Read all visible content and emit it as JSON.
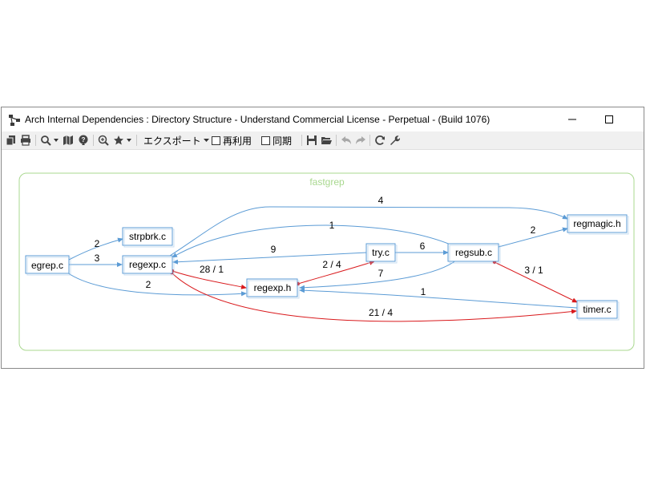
{
  "window": {
    "title": "Arch Internal Dependencies : Directory Structure - Understand Commercial License - Perpetual - (Build 1076)"
  },
  "toolbar": {
    "export_label": "エクスポート",
    "reuse_label": "再利用",
    "sync_label": "同期"
  },
  "graph": {
    "group_label": "fastgrep",
    "nodes": [
      "egrep.c",
      "strpbrk.c",
      "regexp.c",
      "regexp.h",
      "try.c",
      "regsub.c",
      "regmagic.h",
      "timer.c"
    ],
    "edge_labels": {
      "egrep_strpbrk": "2",
      "egrep_regexpc": "3",
      "egrep_regexph": "2",
      "regexpc_regmagic": "4",
      "regsub_regexpc": "1",
      "try_regexpc": "9",
      "try_regsub": "6",
      "regsub_regmagic": "2",
      "regexpc_regexph": "28 / 1",
      "regexph_try": "2 / 4",
      "regsub_regexph": "7",
      "regsub_timer": "3 / 1",
      "timer_regexph": "1",
      "timer_regexpc": "21 / 4"
    },
    "colors": {
      "group_border": "#a9d88f",
      "group_label": "#a9d88f",
      "edge": "#5b9bd5",
      "cycle_edge": "#d9191c",
      "node_border": "#5b9bd5"
    }
  }
}
